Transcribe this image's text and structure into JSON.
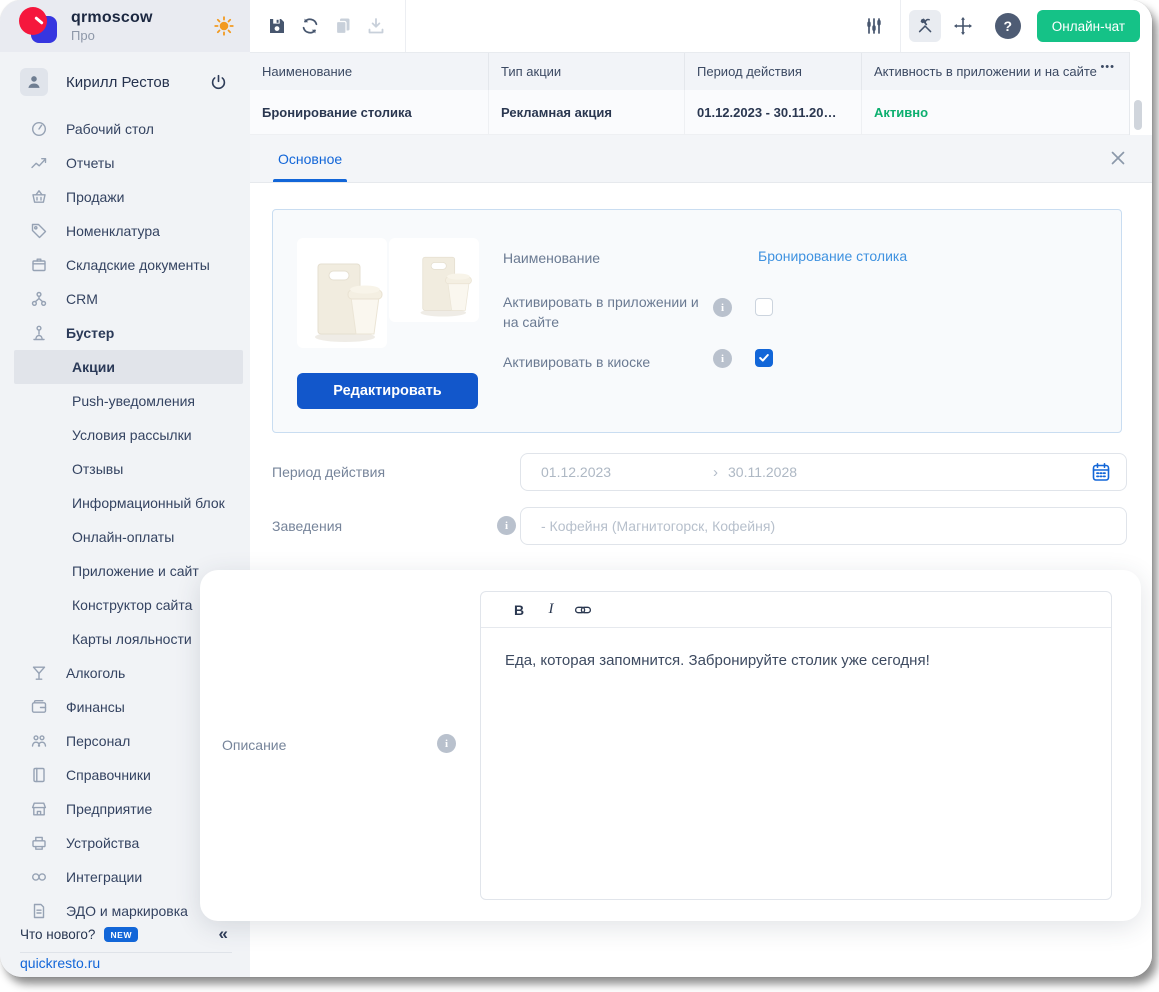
{
  "brand": {
    "title": "qrmoscow",
    "subtitle": "Про"
  },
  "user": {
    "name": "Кирилл Рестов"
  },
  "sidebar": {
    "items": [
      {
        "id": "desktop",
        "label": "Рабочий стол",
        "icon": "desktop",
        "type": "top"
      },
      {
        "id": "reports",
        "label": "Отчеты",
        "icon": "reports",
        "type": "top"
      },
      {
        "id": "sales",
        "label": "Продажи",
        "icon": "sales",
        "type": "top"
      },
      {
        "id": "nomenclature",
        "label": "Номенклатура",
        "icon": "tag",
        "type": "top"
      },
      {
        "id": "warehouse-docs",
        "label": "Складские документы",
        "icon": "warehouse",
        "type": "top"
      },
      {
        "id": "crm",
        "label": "CRM",
        "icon": "crm",
        "type": "top"
      },
      {
        "id": "booster",
        "label": "Бустер",
        "icon": "booster",
        "type": "top",
        "bold": true
      },
      {
        "id": "promotions",
        "label": "Акции",
        "type": "sub",
        "active": true
      },
      {
        "id": "push",
        "label": "Push-уведомления",
        "type": "sub"
      },
      {
        "id": "mailing-terms",
        "label": "Условия рассылки",
        "type": "sub"
      },
      {
        "id": "reviews",
        "label": "Отзывы",
        "type": "sub"
      },
      {
        "id": "info-block",
        "label": "Информационный блок",
        "type": "sub"
      },
      {
        "id": "online-payments",
        "label": "Онлайн-оплаты",
        "type": "sub"
      },
      {
        "id": "app-site",
        "label": "Приложение и сайт",
        "type": "sub"
      },
      {
        "id": "site-builder",
        "label": "Конструктор сайта",
        "type": "sub"
      },
      {
        "id": "loyalty-cards",
        "label": "Карты лояльности",
        "type": "sub"
      },
      {
        "id": "alcohol",
        "label": "Алкоголь",
        "icon": "alcohol",
        "type": "top"
      },
      {
        "id": "finance",
        "label": "Финансы",
        "icon": "finance",
        "type": "top"
      },
      {
        "id": "staff",
        "label": "Персонал",
        "icon": "staff",
        "type": "top"
      },
      {
        "id": "directories",
        "label": "Справочники",
        "icon": "directory",
        "type": "top"
      },
      {
        "id": "enterprise",
        "label": "Предприятие",
        "icon": "enterprise",
        "type": "top"
      },
      {
        "id": "devices",
        "label": "Устройства",
        "icon": "devices",
        "type": "top"
      },
      {
        "id": "integrations",
        "label": "Интеграции",
        "icon": "integrations",
        "type": "top"
      },
      {
        "id": "edo",
        "label": "ЭДО и маркировка",
        "icon": "edo",
        "type": "top"
      }
    ],
    "whats_new": "Что нового?",
    "new_badge": "NEW",
    "site": "quickresto.ru"
  },
  "toolbar": {
    "chat_label": "Онлайн-чат"
  },
  "promo_table": {
    "columns": [
      "Наименование",
      "Тип акции",
      "Период действия",
      "Активность в приложении и на сайте"
    ],
    "row": {
      "name": "Бронирование столика",
      "type": "Рекламная акция",
      "period": "01.12.2023 - 30.11.20…",
      "status": "Активно"
    }
  },
  "tab": {
    "label": "Основное"
  },
  "form": {
    "name_label": "Наименование",
    "name_value": "Бронирование столика",
    "activate_app_label": "Активировать в приложении и на сайте",
    "activate_kiosk_label": "Активировать в киоске",
    "edit_button": "Редактировать",
    "period_label": "Период действия",
    "period_from": "01.12.2023",
    "period_to": "30.11.2028",
    "venues_label": "Заведения",
    "venues_placeholder": "- Кофейня (Магнитогорск, Кофейня)",
    "description_label": "Описание",
    "description_text": "Еда, которая запомнится. Забронируйте столик уже сегодня!",
    "editor_bold": "B",
    "editor_italic": "I"
  },
  "glyphs": {
    "ellipsis": "•••",
    "collapse": "«",
    "help": "?",
    "info": "i",
    "chevron": "›"
  },
  "colors": {
    "accent_blue": "#1266d8",
    "button_blue": "#1257cb",
    "chat_green": "#15c287",
    "status_green": "#0caf6f",
    "link_blue": "#3f92e0"
  }
}
